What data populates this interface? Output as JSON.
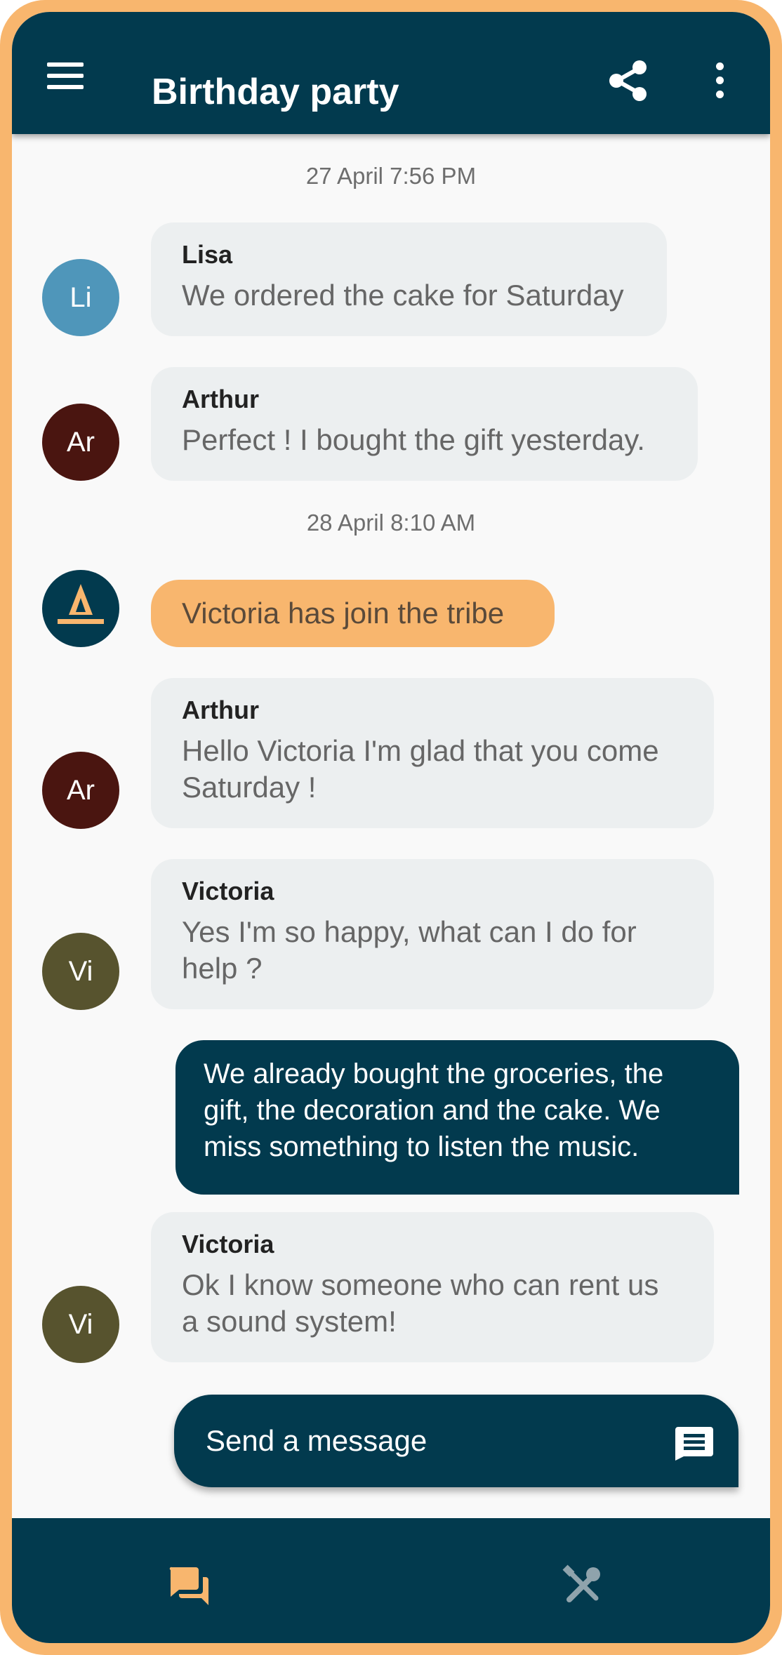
{
  "colors": {
    "primary": "#023A4E",
    "accent": "#F8B66E",
    "bubble": "#ECEFF0",
    "background": "#F9F9F9"
  },
  "header": {
    "title": "Birthday party",
    "icons": [
      "menu-icon",
      "share-icon",
      "more-vert-icon"
    ]
  },
  "messages": [
    {
      "kind": "timestamp",
      "text": "27 April 7:56 PM"
    },
    {
      "kind": "received",
      "initials": "Li",
      "avatar_color": "#4F96BA",
      "sender": "Lisa",
      "text": "We ordered the cake for Saturday"
    },
    {
      "kind": "received",
      "initials": "Ar",
      "avatar_color": "#4A1510",
      "sender": "Arthur",
      "text": "Perfect ! I bought the gift yesterday."
    },
    {
      "kind": "timestamp",
      "text": "28 April 8:10 AM"
    },
    {
      "kind": "system",
      "avatar_icon": "tribe-logo-icon",
      "text": "Victoria has join the tribe"
    },
    {
      "kind": "received",
      "initials": "Ar",
      "avatar_color": "#4A1510",
      "sender": "Arthur",
      "text": "Hello Victoria I'm glad that you come Saturday !"
    },
    {
      "kind": "received",
      "initials": "Vi",
      "avatar_color": "#57532E",
      "sender": "Victoria",
      "text": "Yes I'm so happy, what can I do for help ?"
    },
    {
      "kind": "sent",
      "text": "We already bought the groceries, the gift, the decoration and the cake. We miss something to listen the music."
    },
    {
      "kind": "received",
      "initials": "Vi",
      "avatar_color": "#57532E",
      "sender": "Victoria",
      "text": "Ok I know someone who can rent us a sound system!"
    }
  ],
  "composer": {
    "placeholder": "Send a message",
    "icon": "send-message-icon"
  },
  "bottom_nav": [
    {
      "icon": "chat-bubbles-icon",
      "active": true
    },
    {
      "icon": "tools-icon",
      "active": false
    }
  ]
}
